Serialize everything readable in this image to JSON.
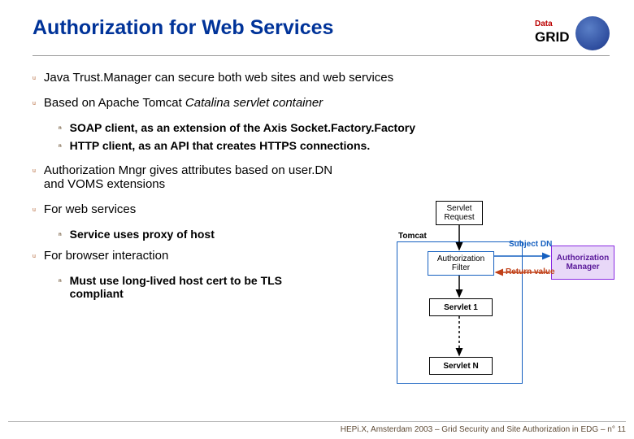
{
  "title": "Authorization for Web Services",
  "logo": {
    "top": "Data",
    "main": "GRID"
  },
  "bullets": {
    "b1": "Java Trust.Manager can secure both web sites and web services",
    "b2": "Based on Apache Tomcat ",
    "b2_italic": "Catalina servlet container",
    "b2a": "SOAP client, as an extension of the Axis Socket.Factory.Factory",
    "b2b": "HTTP client, as an API that creates HTTPS connections.",
    "b3": "Authorization Mngr gives attributes based on user.DN and VOMS extensions",
    "b4": "For web services",
    "b4a": "Service uses proxy of host",
    "b5": "For browser interaction",
    "b5a": "Must use long-lived host cert to be TLS compliant"
  },
  "diagram": {
    "servlet_request": "Servlet\nRequest",
    "tomcat": "Tomcat",
    "auth_filter": "Authorization\nFilter",
    "auth_manager": "Authorization\nManager",
    "subject_dn": "Subject DN",
    "return_value": "Return value",
    "servlet_1": "Servlet 1",
    "servlet_n": "Servlet N"
  },
  "footer": "HEPi.X, Amsterdam 2003 – Grid Security and Site Authorization in EDG –  n° 11"
}
